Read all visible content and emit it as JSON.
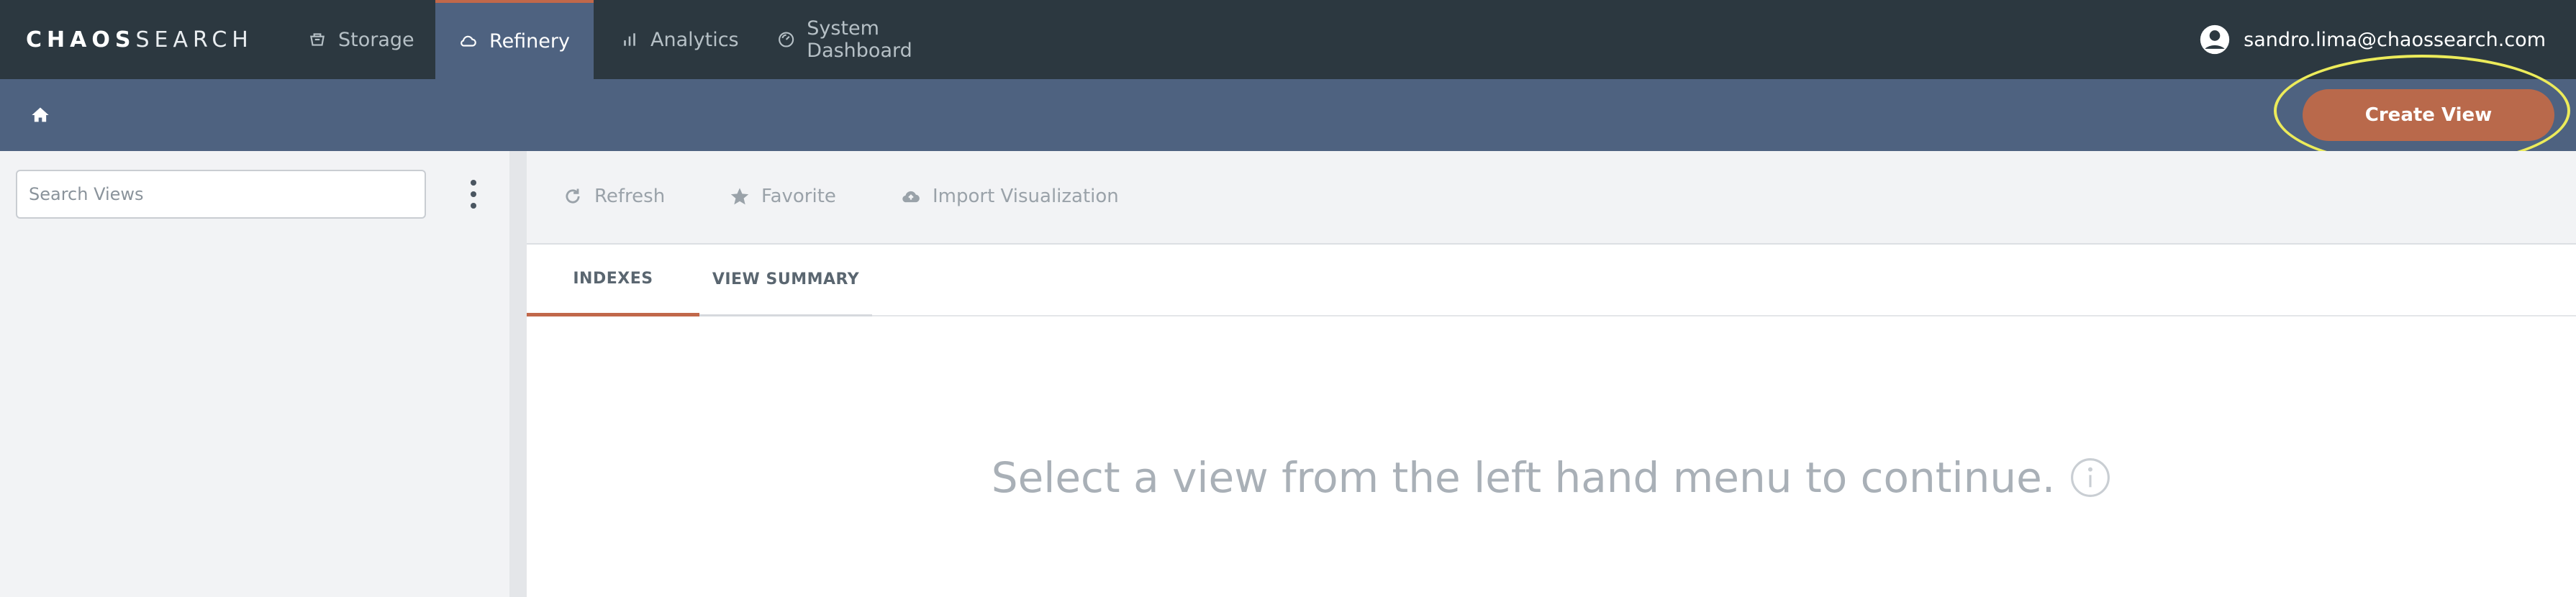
{
  "brand": {
    "logo_bold": "CHAOS",
    "logo_light": "SEARCH"
  },
  "nav": {
    "items": [
      {
        "label": "Storage",
        "icon": "storage-icon"
      },
      {
        "label": "Refinery",
        "icon": "cloud-icon",
        "active": true
      },
      {
        "label": "Analytics",
        "icon": "bar-chart-icon"
      },
      {
        "label": "System Dashboard",
        "icon": "dashboard-icon"
      }
    ]
  },
  "user": {
    "email": "sandro.lima@chaossearch.com",
    "icon": "account-circle-icon"
  },
  "subbar": {
    "home_icon": "home-icon",
    "create_label": "Create View"
  },
  "sidebar": {
    "search_placeholder": "Search Views",
    "search_value": "",
    "menu_icon": "kebab-menu-icon"
  },
  "toolbar": {
    "refresh_label": "Refresh",
    "favorite_label": "Favorite",
    "import_label": "Import Visualization"
  },
  "tabs": [
    {
      "label": "INDEXES",
      "active": true
    },
    {
      "label": "VIEW SUMMARY",
      "active": false
    }
  ],
  "empty_state": {
    "message": "Select a view from the left hand menu to continue.",
    "icon": "info-icon"
  },
  "colors": {
    "topbar": "#2c3840",
    "subbar": "#4e6280",
    "accent": "#c1684a",
    "button": "#b9694b",
    "highlight": "#eceb5a"
  }
}
